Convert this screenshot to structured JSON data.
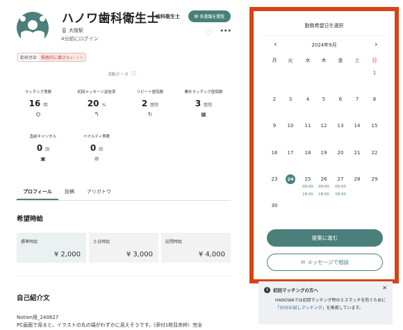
{
  "profile": {
    "name": "ハノワ歯科衛生士",
    "role": "歯科衛生士",
    "cert_button": "各書類を閲覧",
    "location": "大阪駅",
    "last_login": "4分前にログイン"
  },
  "badge": {
    "key": "勤務意欲",
    "value": "積極的に働きたい"
  },
  "activity_label": "活動データ",
  "stats": [
    {
      "label": "マッチング実数",
      "value": "16",
      "unit": "回",
      "icon": "handshake-icon"
    },
    {
      "label": "初回メッセージ返信率",
      "value": "20",
      "unit": "%",
      "icon": "reply-icon"
    },
    {
      "label": "リピート医院数",
      "value": "2",
      "unit": "医院",
      "icon": "repeat-icon"
    },
    {
      "label": "累計マッチング医院数",
      "value": "3",
      "unit": "医院",
      "icon": "building-icon"
    },
    {
      "label": "直前キャンセル",
      "value": "0",
      "unit": "回",
      "icon": "calendar-icon"
    },
    {
      "label": "ペナルティ実数",
      "value": "0",
      "unit": "回",
      "icon": "ban-icon"
    }
  ],
  "tabs": [
    "プロフィール",
    "投稿",
    "アリガトウ"
  ],
  "desired": {
    "title": "希望時給",
    "rates": [
      {
        "label": "標準時給",
        "value": "¥ 2,000"
      },
      {
        "label": "土日時給",
        "value": "¥ 3,000"
      },
      {
        "label": "訪問時給",
        "value": "¥ 4,000"
      }
    ]
  },
  "intro": {
    "title": "自己紹介文",
    "line1": "Notion用_240827",
    "line2": "PC画面で見ると、イラストの丸の端がわずかに見えそうです。(添付1枚目赤枠）完全"
  },
  "calendar": {
    "title": "勤務希望日を選択",
    "month": "2024年9月",
    "weekdays": [
      "月",
      "火",
      "水",
      "木",
      "金",
      "土",
      "日"
    ],
    "weeks": [
      [
        "",
        "",
        "",
        "",
        "",
        "",
        "1"
      ],
      [
        "2",
        "3",
        "4",
        "5",
        "6",
        "7",
        "8"
      ],
      [
        "9",
        "10",
        "11",
        "12",
        "13",
        "14",
        "15"
      ],
      [
        "16",
        "17",
        "18",
        "19",
        "20",
        "21",
        "22"
      ],
      [
        "23",
        "24",
        "25",
        "26",
        "27",
        "28",
        "29"
      ],
      [
        "30",
        "",
        "",
        "",
        "",
        "",
        ""
      ]
    ],
    "selected_day": "24",
    "slots": {
      "25": [
        "09:00",
        "18:00"
      ],
      "26": [
        "09:00",
        "18:00"
      ],
      "27": [
        "09:00",
        "18:00"
      ]
    },
    "primary_button": "提案に進む",
    "secondary_button": "メッセージで相談",
    "colors": {
      "sat": "#2e8b57",
      "sun": "#d32f2f",
      "accent": "#4b7f7c"
    }
  },
  "info": {
    "title": "初回マッチングの方へ",
    "body_pre": "HANOWAでは初回マッチング時のミスマッチを防ぐために「",
    "body_link": "30分お試しマッチング",
    "body_post": "」を推奨しています。"
  }
}
